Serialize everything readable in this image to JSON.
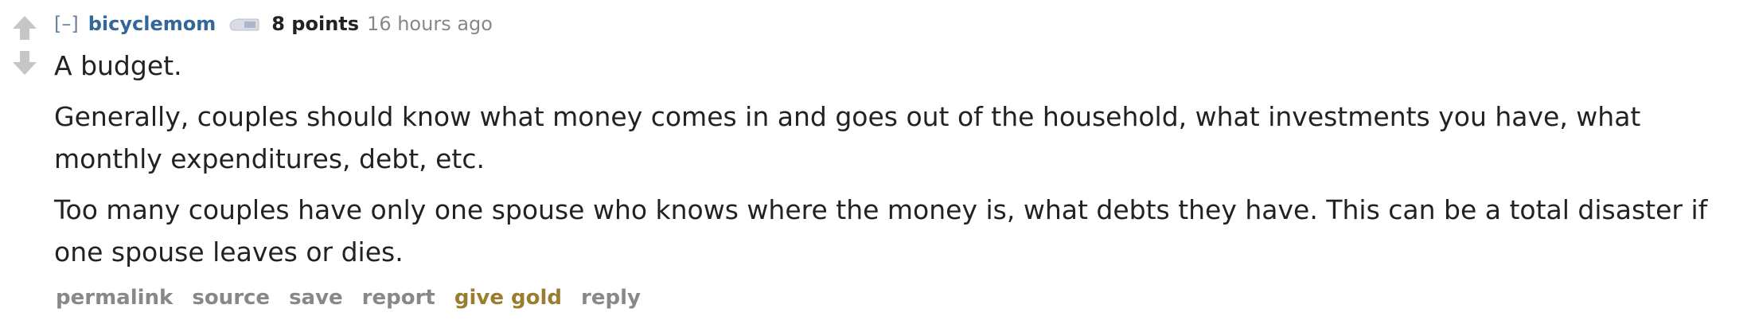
{
  "comment": {
    "expand_toggle": "[–]",
    "author": "bicyclemom",
    "score": "8 points",
    "time": "16 hours ago",
    "paragraphs": [
      "A budget.",
      "Generally, couples should know what money comes in and goes out of the household, what investments you have, what monthly expenditures, debt, etc.",
      "Too many couples have only one spouse who knows where the money is, what debts they have. This can be a total disaster if one spouse leaves or dies."
    ],
    "buttons": {
      "permalink": "permalink",
      "source": "source",
      "save": "save",
      "report": "report",
      "give_gold": "give gold",
      "reply": "reply"
    }
  },
  "icons": {
    "upvote": "upvote-arrow-icon",
    "downvote": "downvote-arrow-icon",
    "flair": "user-flair-icon"
  },
  "colors": {
    "author": "#336699",
    "expand": "#6b7f9e",
    "meta": "#888888",
    "text": "#222222",
    "gold": "#9a7d2e",
    "arrow": "#c6c6c6"
  }
}
